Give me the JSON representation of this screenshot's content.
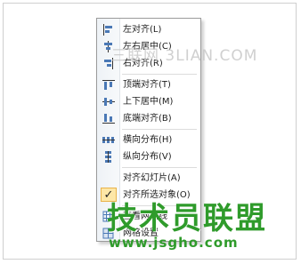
{
  "menu": {
    "items": [
      {
        "label": "左对齐(L)",
        "icon": "align-left-icon"
      },
      {
        "label": "左右居中(C)",
        "icon": "align-center-icon"
      },
      {
        "label": "右对齐(R)",
        "icon": "align-right-icon"
      },
      {
        "label": "顶端对齐(T)",
        "icon": "align-top-icon"
      },
      {
        "label": "上下居中(M)",
        "icon": "align-middle-icon"
      },
      {
        "label": "底端对齐(B)",
        "icon": "align-bottom-icon"
      },
      {
        "label": "横向分布(H)",
        "icon": "distribute-horizontal-icon"
      },
      {
        "label": "纵向分布(V)",
        "icon": "distribute-vertical-icon"
      },
      {
        "label": "对齐幻灯片(A)",
        "icon": ""
      },
      {
        "label": "对齐所选对象(O)",
        "icon": "checkmark-icon",
        "checked": true
      },
      {
        "label": "查看网格线",
        "icon": "gridlines-icon"
      },
      {
        "label": "网格设置",
        "icon": "grid-settings-icon"
      }
    ]
  },
  "watermark": {
    "top_text": "三联网 3LIAN.COM",
    "bottom_title": "技术员联盟",
    "bottom_url": "www.jsgho.com",
    "color": "#2f9b2b"
  },
  "checkmark_glyph": "✓"
}
